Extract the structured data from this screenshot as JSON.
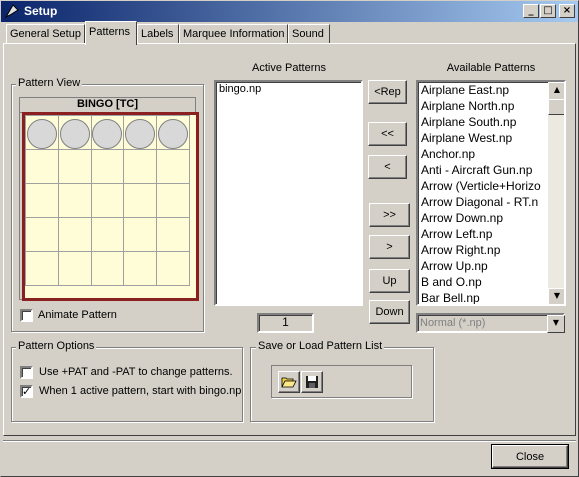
{
  "window": {
    "title": "Setup"
  },
  "tabs": [
    {
      "label": "General Setup"
    },
    {
      "label": "Patterns"
    },
    {
      "label": "Labels"
    },
    {
      "label": "Marquee Information"
    },
    {
      "label": "Sound"
    }
  ],
  "pattern_view": {
    "group_label": "Pattern View",
    "card_title": "BINGO [TC]",
    "marked_row": "top",
    "animate_label": "Animate Pattern",
    "animate_checked": false
  },
  "active_patterns": {
    "label": "Active Patterns",
    "items": [
      "bingo.np"
    ],
    "count": "1"
  },
  "move_buttons": {
    "rep": "<Rep",
    "all_left": "<<",
    "left": "<",
    "all_right": ">>",
    "right": ">",
    "up": "Up",
    "down": "Down"
  },
  "available_patterns": {
    "label": "Available Patterns",
    "items": [
      "Airplane East.np",
      "Airplane North.np",
      "Airplane South.np",
      "Airplane West.np",
      "Anchor.np",
      "Anti - Aircraft Gun.np",
      "Arrow (Verticle+Horizo",
      "Arrow Diagonal - RT.n",
      "Arrow Down.np",
      "Arrow Left.np",
      "Arrow Right.np",
      "Arrow Up.np",
      "B and O.np",
      "Bar Bell.np"
    ],
    "filter": "Normal (*.np)"
  },
  "pattern_options": {
    "group_label": "Pattern Options",
    "option1": "Use +PAT and -PAT to change patterns.",
    "option1_checked": false,
    "option2": "When 1 active pattern, start with bingo.np",
    "option2_checked": true
  },
  "save_load": {
    "group_label": "Save or Load Pattern List",
    "open_icon": "folder-open-icon",
    "save_icon": "floppy-disk-icon"
  },
  "footer": {
    "close_label": "Close"
  }
}
